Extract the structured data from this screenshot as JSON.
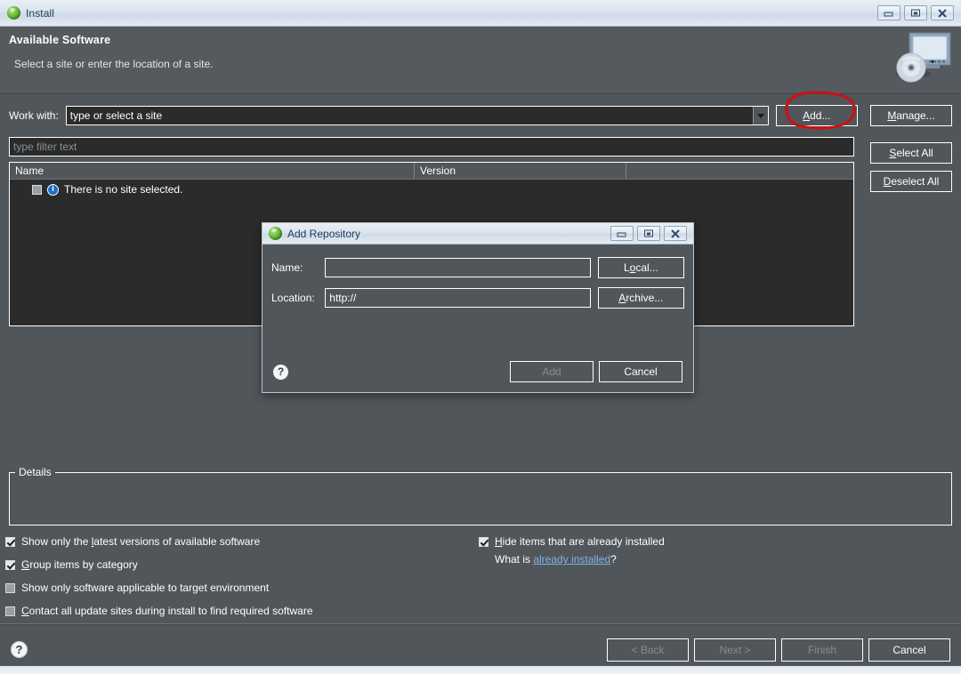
{
  "window": {
    "title": "Install",
    "icon": "eclipse-icon",
    "buttons": {
      "minimize": "minimize-icon",
      "maximize": "maximize-icon",
      "close": "close-icon"
    }
  },
  "header": {
    "title": "Available Software",
    "subtitle": "Select a site or enter the location of a site.",
    "graphic": "monitor-disc-icon"
  },
  "work_with": {
    "label": "Work with:",
    "value": "type or select a site",
    "placeholder": "type or select a site",
    "add_label": "Add...",
    "add_mnemonic": "A"
  },
  "side_buttons": [
    {
      "label": "Manage...",
      "mnemonic": "M",
      "enabled": true
    },
    {
      "label": "Select All",
      "mnemonic": "S",
      "enabled": true
    },
    {
      "label": "Deselect All",
      "mnemonic": "D",
      "enabled": true
    }
  ],
  "filter": {
    "placeholder": "type filter text",
    "value": ""
  },
  "table": {
    "columns": [
      "Name",
      "Version",
      ""
    ],
    "rows": [
      {
        "checked": false,
        "icon": "info-icon",
        "name": "There is no site selected.",
        "version": ""
      }
    ]
  },
  "details": {
    "legend": "Details",
    "content": ""
  },
  "options_left": [
    {
      "label": "Show only the latest versions of available software",
      "mnemonic": "l",
      "checked": true
    },
    {
      "label": "Group items by category",
      "mnemonic": "G",
      "checked": true
    },
    {
      "label": "Show only software applicable to target environment",
      "mnemonic": "",
      "checked": false
    },
    {
      "label": "Contact all update sites during install to find required software",
      "mnemonic": "C",
      "checked": false
    }
  ],
  "options_right": [
    {
      "label": "Hide items that are already installed",
      "mnemonic": "H",
      "checked": true
    }
  ],
  "already_installed": {
    "prefix": "What is ",
    "link": "already installed",
    "suffix": "?"
  },
  "footer": {
    "help": "?",
    "buttons": [
      {
        "label": "< Back",
        "enabled": false
      },
      {
        "label": "Next >",
        "enabled": false
      },
      {
        "label": "Finish",
        "enabled": false
      },
      {
        "label": "Cancel",
        "enabled": true
      }
    ]
  },
  "dialog": {
    "title": "Add Repository",
    "icon": "eclipse-icon",
    "name_label": "Name:",
    "name_value": "",
    "location_label": "Location:",
    "location_value": "http://",
    "local_label": "Local...",
    "archive_label": "Archive...",
    "help": "?",
    "add_label": "Add",
    "add_enabled": false,
    "cancel_label": "Cancel",
    "cancel_enabled": true
  },
  "annotation": {
    "shape": "red-ellipse",
    "color": "#cc1111",
    "target": "Add..."
  },
  "colors": {
    "background": "#51565a",
    "field_dark": "#2b2b2b",
    "titlebar": "#dbe4ec",
    "text": "#ffffff",
    "link": "#7fb2e8",
    "disabled_text": "#868c91",
    "annotation_red": "#cc1111"
  }
}
